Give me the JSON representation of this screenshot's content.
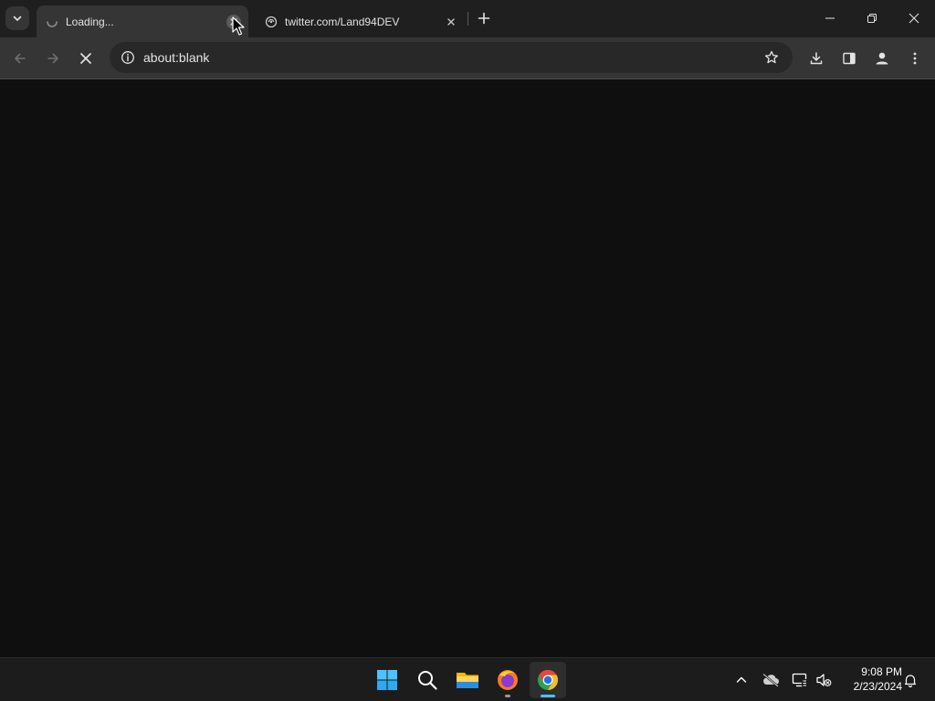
{
  "browser": {
    "tabs": [
      {
        "title": "Loading...",
        "active": true
      },
      {
        "title": "twitter.com/Land94DEV",
        "active": false
      }
    ],
    "address_bar": {
      "url": "about:blank"
    }
  },
  "taskbar": {
    "apps": [
      "windows-start",
      "search",
      "file-explorer",
      "firefox",
      "chrome"
    ],
    "clock": {
      "time": "9:08 PM",
      "date": "2/23/2024"
    }
  },
  "colors": {
    "accent": "#4cc2ff",
    "tab_active": "#353535",
    "tabstrip": "#1f1f1f",
    "content": "#0f0f0f"
  }
}
